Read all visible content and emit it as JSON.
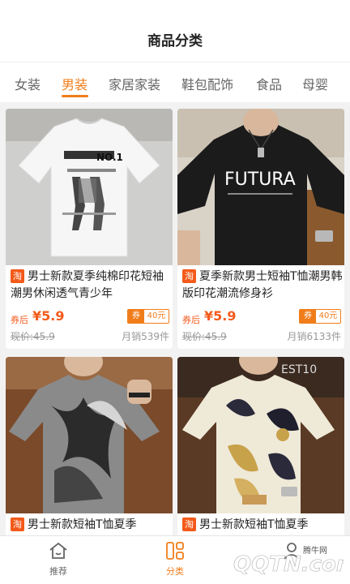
{
  "header": {
    "title": "商品分类"
  },
  "tabs": [
    {
      "label": "女装",
      "active": false
    },
    {
      "label": "男装",
      "active": true
    },
    {
      "label": "家居家装",
      "active": false
    },
    {
      "label": "鞋包配饰",
      "active": false
    },
    {
      "label": "食品",
      "active": false
    },
    {
      "label": "母婴",
      "active": false
    }
  ],
  "colors": {
    "accent": "#f07d1a",
    "price": "#f35a1a",
    "taobao_badge": "#f35a1a"
  },
  "products": [
    {
      "badge": "淘",
      "title": "男士新款夏季纯棉印花短袖潮男休闲透气青少年",
      "price_prefix": "券后",
      "price": "¥5.9",
      "coupon_label": "券",
      "coupon_value": "40元",
      "original_price": "现价:45.9",
      "monthly_sales": "月销539件",
      "image_print": "NO.1"
    },
    {
      "badge": "淘",
      "title": "夏季新款男士短袖T恤潮男韩版印花潮流修身衫",
      "price_prefix": "券后",
      "price": "¥5.9",
      "coupon_label": "券",
      "coupon_value": "40元",
      "original_price": "现价:45.9",
      "monthly_sales": "月销6133件",
      "image_print": "FUTURA"
    },
    {
      "badge": "淘",
      "title": "男士新款短袖T恤夏季",
      "image_print": ""
    },
    {
      "badge": "淘",
      "title": "男士新款短袖T恤夏季",
      "image_print": ""
    }
  ],
  "bottom_nav": [
    {
      "label": "推荐",
      "icon": "home-icon",
      "active": false
    },
    {
      "label": "分类",
      "icon": "category-icon",
      "active": true
    },
    {
      "label": "",
      "icon": "profile-icon",
      "active": false
    }
  ],
  "watermark": {
    "text": "QQTN.com",
    "small": "腾牛网"
  }
}
